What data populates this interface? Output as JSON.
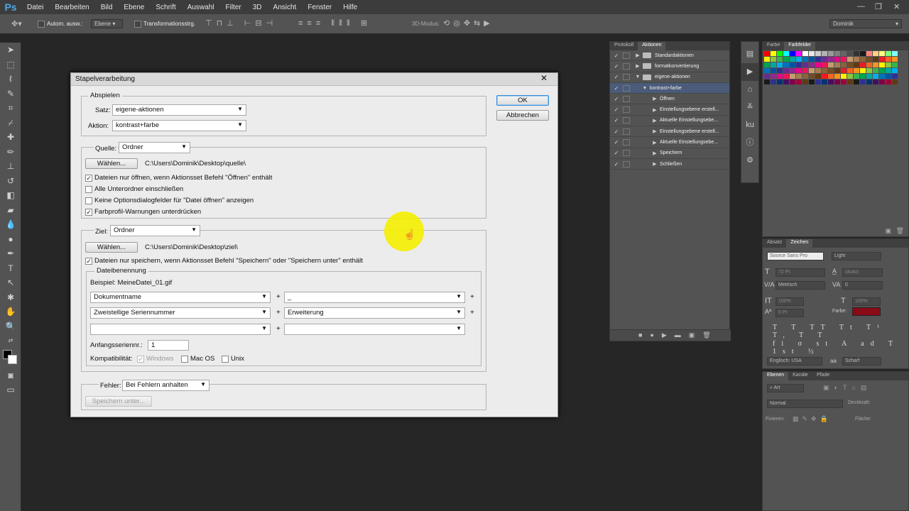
{
  "app": {
    "logo": "Ps",
    "menus": [
      "Datei",
      "Bearbeiten",
      "Bild",
      "Ebene",
      "Schrift",
      "Auswahl",
      "Filter",
      "3D",
      "Ansicht",
      "Fenster",
      "Hilfe"
    ],
    "workspace": "Dominik"
  },
  "options": {
    "auto_select": "Autom. ausw.:",
    "auto_select_target": "Ebene",
    "transform_controls": "Transformationsstrg.",
    "mode_3d": "3D-Modus:"
  },
  "actions_panel": {
    "tabs": [
      "Protokoll",
      "Aktionen"
    ],
    "rows": [
      {
        "label": "Standardaktionen",
        "type": "set",
        "expanded": false
      },
      {
        "label": "formatkonvertierung",
        "type": "set",
        "expanded": false
      },
      {
        "label": "eigene-aktionen",
        "type": "set",
        "expanded": true
      },
      {
        "label": "kontrast+farbe",
        "type": "action",
        "expanded": true,
        "selected": true
      },
      {
        "label": "Öffnen",
        "type": "step"
      },
      {
        "label": "Einstellungsebene erstell...",
        "type": "step"
      },
      {
        "label": "Aktuelle Einstellungsebe...",
        "type": "step"
      },
      {
        "label": "Einstellungsebene erstell...",
        "type": "step"
      },
      {
        "label": "Aktuelle Einstellungsebe...",
        "type": "step"
      },
      {
        "label": "Speichern",
        "type": "step"
      },
      {
        "label": "Schließen",
        "type": "step"
      }
    ]
  },
  "swatches_panel": {
    "tabs": [
      "Farbe",
      "Farbfelder"
    ]
  },
  "char_panel": {
    "tabs": [
      "Absatz",
      "Zeichen"
    ],
    "font": "Source Sans Pro",
    "style": "Light",
    "size": "72 Pt",
    "leading": "(Auto)",
    "kerning": "Metrisch",
    "tracking": "0",
    "vscale": "100%",
    "hscale": "100%",
    "baseline": "0 Pt",
    "color_label": "Farbe:",
    "color": "#8b0a18",
    "language": "Englisch: USA",
    "aa_label": "aa",
    "antialias": "Scharf"
  },
  "layers_panel": {
    "tabs": [
      "Ebenen",
      "Kanäle",
      "Pfade"
    ],
    "kind": "Art",
    "blend": "Normal",
    "opacity_label": "Deckkraft:",
    "lock_label": "Fixieren:",
    "fill_label": "Fläche:"
  },
  "dialog": {
    "title": "Stapelverarbeitung",
    "ok": "OK",
    "cancel": "Abbrechen",
    "play": {
      "group": "Abspielen",
      "set_label": "Satz:",
      "set_value": "eigene-aktionen",
      "action_label": "Aktion:",
      "action_value": "kontrast+farbe"
    },
    "source": {
      "label": "Quelle:",
      "value": "Ordner",
      "choose": "Wählen...",
      "path": "C:\\Users\\Dominik\\Desktop\\quelle\\",
      "opts": [
        {
          "label": "Dateien nur öffnen, wenn Aktionsset Befehl \"Öffnen\" enthält",
          "checked": true
        },
        {
          "label": "Alle Unterordner einschließen",
          "checked": false
        },
        {
          "label": "Keine Optionsdialogfelder für \"Datei öffnen\" anzeigen",
          "checked": false
        },
        {
          "label": "Farbprofil-Warnungen unterdrücken",
          "checked": true
        }
      ]
    },
    "target": {
      "label": "Ziel:",
      "value": "Ordner",
      "choose": "Wählen...",
      "path": "C:\\Users\\Dominik\\Desktop\\ziel\\",
      "save_opt": "Dateien nur speichern, wenn Aktionsset Befehl \"Speichern\" oder \"Speichern unter\" enthält",
      "naming": {
        "group": "Dateibenennung",
        "example": "Beispiel: MeineDatei_01.gif",
        "fields": [
          "Dokumentname",
          "_",
          "Zweistellige Seriennummer",
          "Erweiterung",
          "",
          ""
        ],
        "start_label": "Anfangsseriennr.:",
        "start_value": "1",
        "compat_label": "Kompatibilität:",
        "compat": [
          "Windows",
          "Mac OS",
          "Unix"
        ]
      }
    },
    "errors": {
      "label": "Fehler:",
      "value": "Bei Fehlern anhalten",
      "save_as": "Speichern unter..."
    }
  },
  "colors": {
    "accent": "#3b8fd9",
    "highlight": "#f5f000"
  }
}
